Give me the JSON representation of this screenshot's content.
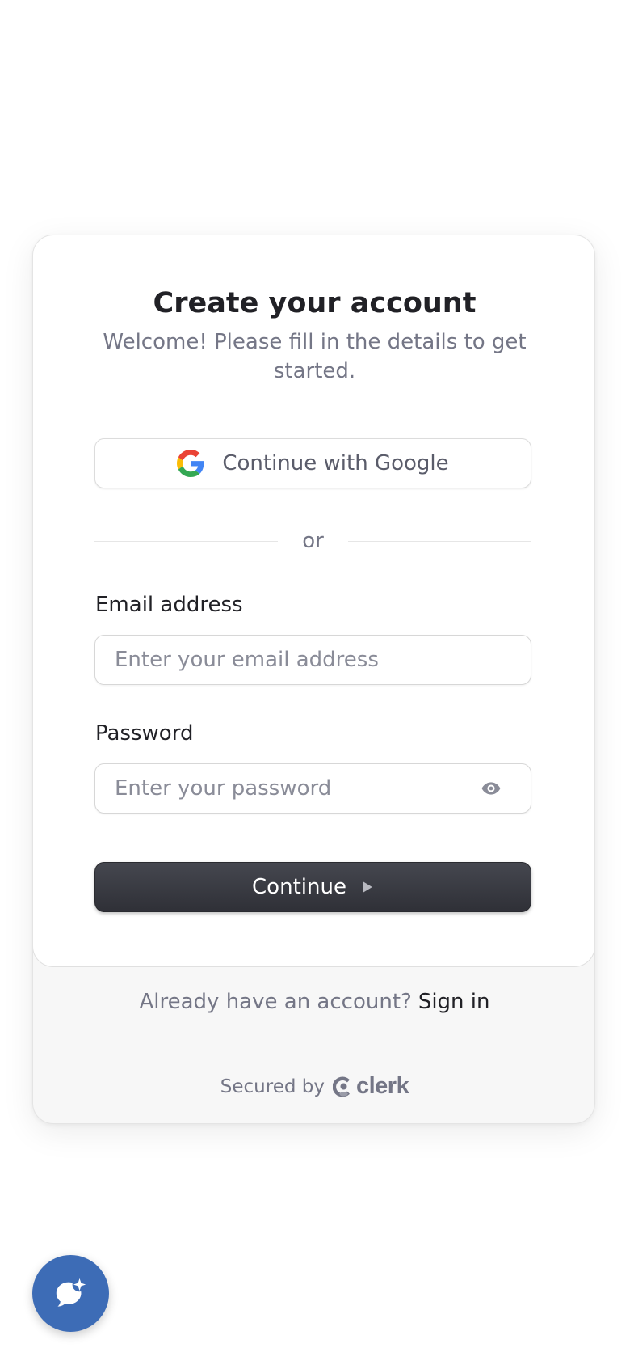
{
  "signup": {
    "title": "Create your account",
    "subtitle": "Welcome! Please fill in the details to get started.",
    "google_button_label": "Continue with Google",
    "divider_text": "or",
    "email": {
      "label": "Email address",
      "placeholder": "Enter your email address",
      "value": ""
    },
    "password": {
      "label": "Password",
      "placeholder": "Enter your password",
      "value": ""
    },
    "continue_label": "Continue"
  },
  "footer": {
    "signin_prompt": "Already have an account?",
    "signin_link": "Sign in",
    "secured_by": "Secured by",
    "brand": "clerk"
  },
  "icons": {
    "google": "google-g-icon",
    "eye": "eye-icon",
    "arrow": "play-arrow-icon",
    "clerk": "clerk-logo-icon",
    "chat": "chat-bubble-sparkle-icon"
  },
  "colors": {
    "primary_button": "#2f3037",
    "fab": "#3d6cb6",
    "muted_text": "#747686",
    "heading_text": "#212126"
  }
}
